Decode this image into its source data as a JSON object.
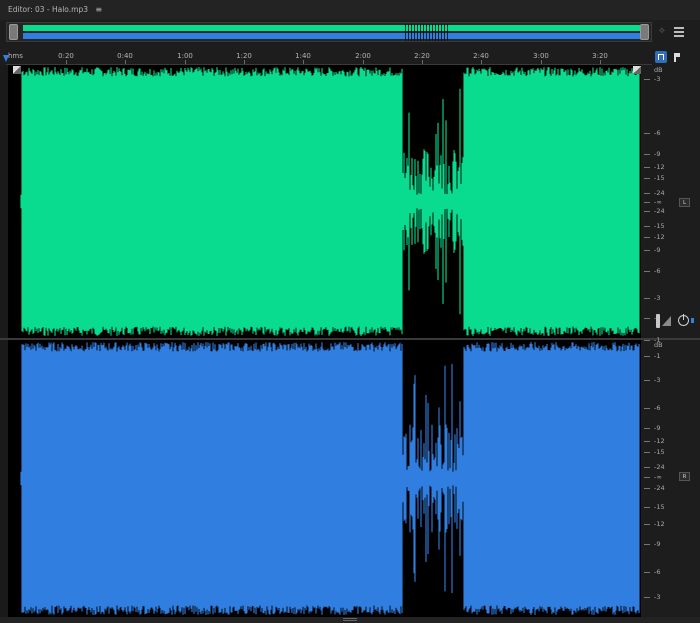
{
  "window": {
    "title": "Editor: 03 - Halo.mp3",
    "menu_icon": "hamburger-menu-icon"
  },
  "colors": {
    "left_channel": "#09dc8f",
    "right_channel": "#2f7ee0",
    "background": "#1d1d1d",
    "playhead": "#2f82e0"
  },
  "ruler": {
    "unit_label": "hms",
    "labels": [
      "0:20",
      "0:40",
      "1:00",
      "1:20",
      "1:40",
      "2:00",
      "2:20",
      "2:40",
      "3:00",
      "3:20"
    ]
  },
  "channels": [
    {
      "id": "L",
      "badge": "L",
      "db_labels": [
        "dB",
        "-3",
        "-6",
        "-9",
        "-12",
        "-15",
        "-24",
        "-∞",
        "-24",
        "-15",
        "-12",
        "-9",
        "-6",
        "-3",
        "-1"
      ]
    },
    {
      "id": "R",
      "badge": "R",
      "db_labels": [
        "dB",
        "-1",
        "-3",
        "-6",
        "-9",
        "-12",
        "-15",
        "-24",
        "-∞",
        "-24",
        "-15",
        "-12",
        "-9",
        "-6",
        "-3",
        "-1"
      ]
    }
  ]
}
